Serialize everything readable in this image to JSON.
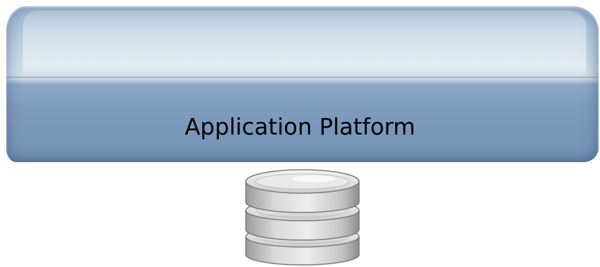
{
  "diagram": {
    "platform": {
      "label": "Application Platform",
      "fill_colors": [
        "#98b3cd",
        "#d2dee9",
        "#7f9cbd"
      ]
    },
    "database": {
      "icon": "database-icon",
      "disk_count": 3,
      "fill_colors": [
        "#e6e6e6",
        "#cfcfcf",
        "#8f8f8f"
      ]
    }
  }
}
